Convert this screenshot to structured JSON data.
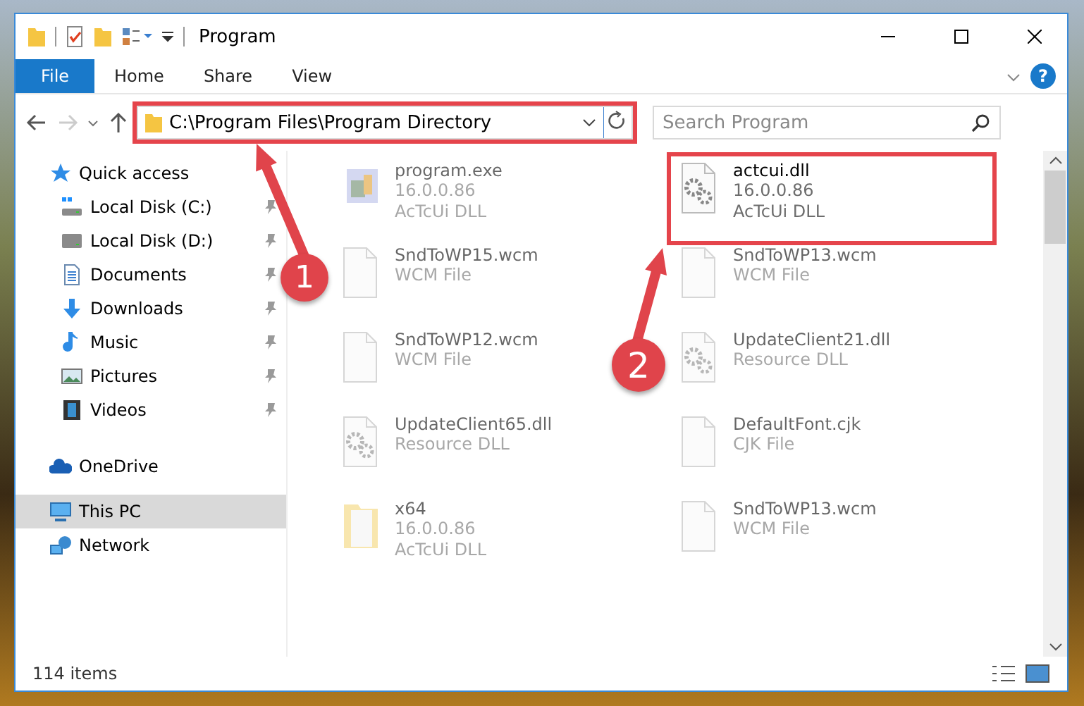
{
  "window": {
    "title": "Program"
  },
  "ribbon": {
    "tabs": [
      {
        "label": "File",
        "selected": true
      },
      {
        "label": "Home",
        "selected": false
      },
      {
        "label": "Share",
        "selected": false
      },
      {
        "label": "View",
        "selected": false
      }
    ],
    "help": "?"
  },
  "address_bar": {
    "path": "C:\\Program Files\\Program Directory",
    "highlighted": true
  },
  "search": {
    "placeholder": "Search Program"
  },
  "sidebar": {
    "items": [
      {
        "label": "Quick access",
        "selected": false,
        "children": [
          {
            "label": "Local Disk (C:)",
            "pinned": true,
            "selected": false
          },
          {
            "label": "Local Disk (D:)",
            "pinned": true,
            "selected": false
          },
          {
            "label": "Documents",
            "pinned": true,
            "selected": false
          },
          {
            "label": "Downloads",
            "pinned": true,
            "selected": false
          },
          {
            "label": "Music",
            "pinned": true,
            "selected": false
          },
          {
            "label": "Pictures",
            "pinned": true,
            "selected": false
          },
          {
            "label": "Videos",
            "pinned": true,
            "selected": false
          }
        ]
      },
      {
        "label": "OneDrive",
        "selected": false
      },
      {
        "label": "This PC",
        "selected": true
      },
      {
        "label": "Network",
        "selected": false
      }
    ]
  },
  "files": [
    {
      "name": "program.exe",
      "details": [
        "16.0.0.86",
        "AcTcUi DLL"
      ],
      "dimmed": true,
      "highlighted": false
    },
    {
      "name": "actcui.dll",
      "details": [
        "16.0.0.86",
        "AcTcUi DLL"
      ],
      "dimmed": false,
      "highlighted": true
    },
    {
      "name": "SndToWP15.wcm",
      "details": [
        "WCM File"
      ],
      "dimmed": true,
      "highlighted": false
    },
    {
      "name": "SndToWP13.wcm",
      "details": [
        "WCM File"
      ],
      "dimmed": true,
      "highlighted": false
    },
    {
      "name": "SndToWP12.wcm",
      "details": [
        "WCM File"
      ],
      "dimmed": true,
      "highlighted": false
    },
    {
      "name": "UpdateClient21.dll",
      "details": [
        "Resource DLL"
      ],
      "dimmed": true,
      "highlighted": false
    },
    {
      "name": "UpdateClient65.dll",
      "details": [
        "Resource DLL"
      ],
      "dimmed": true,
      "highlighted": false
    },
    {
      "name": "DefaultFont.cjk",
      "details": [
        "CJK File"
      ],
      "dimmed": true,
      "highlighted": false
    },
    {
      "name": "x64",
      "details": [
        "16.0.0.86",
        "AcTcUi DLL"
      ],
      "dimmed": true,
      "highlighted": false
    },
    {
      "name": "SndToWP13.wcm",
      "details": [
        "WCM File"
      ],
      "dimmed": true,
      "highlighted": false
    }
  ],
  "status_bar": {
    "text": "114 items"
  },
  "callouts": [
    {
      "number": "1"
    },
    {
      "number": "2"
    }
  ]
}
